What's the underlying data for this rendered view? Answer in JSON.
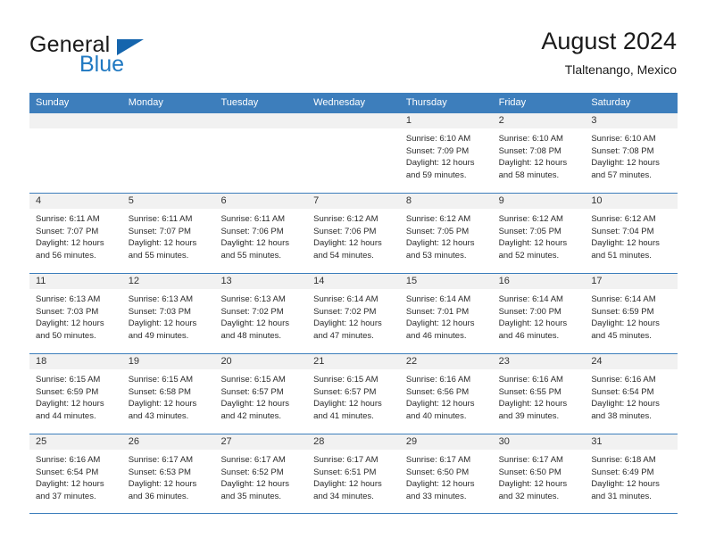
{
  "brand": {
    "name_part1": "General",
    "name_part2": "Blue",
    "flag_icon": "triangle-flag-icon"
  },
  "header": {
    "title": "August 2024",
    "subtitle": "Tlaltenango, Mexico"
  },
  "colors": {
    "header_blue": "#3d7ebc",
    "brand_blue": "#1f78c1",
    "flag_blue": "#1565ad",
    "day_band_gray": "#f1f1f1"
  },
  "weekdays": [
    "Sunday",
    "Monday",
    "Tuesday",
    "Wednesday",
    "Thursday",
    "Friday",
    "Saturday"
  ],
  "weeks": [
    [
      {
        "day": "",
        "empty": true,
        "sunrise": "",
        "sunset": "",
        "daylight_line1": "",
        "daylight_line2": ""
      },
      {
        "day": "",
        "empty": true,
        "sunrise": "",
        "sunset": "",
        "daylight_line1": "",
        "daylight_line2": ""
      },
      {
        "day": "",
        "empty": true,
        "sunrise": "",
        "sunset": "",
        "daylight_line1": "",
        "daylight_line2": ""
      },
      {
        "day": "",
        "empty": true,
        "sunrise": "",
        "sunset": "",
        "daylight_line1": "",
        "daylight_line2": ""
      },
      {
        "day": "1",
        "empty": false,
        "sunrise": "Sunrise: 6:10 AM",
        "sunset": "Sunset: 7:09 PM",
        "daylight_line1": "Daylight: 12 hours",
        "daylight_line2": "and 59 minutes."
      },
      {
        "day": "2",
        "empty": false,
        "sunrise": "Sunrise: 6:10 AM",
        "sunset": "Sunset: 7:08 PM",
        "daylight_line1": "Daylight: 12 hours",
        "daylight_line2": "and 58 minutes."
      },
      {
        "day": "3",
        "empty": false,
        "sunrise": "Sunrise: 6:10 AM",
        "sunset": "Sunset: 7:08 PM",
        "daylight_line1": "Daylight: 12 hours",
        "daylight_line2": "and 57 minutes."
      }
    ],
    [
      {
        "day": "4",
        "empty": false,
        "sunrise": "Sunrise: 6:11 AM",
        "sunset": "Sunset: 7:07 PM",
        "daylight_line1": "Daylight: 12 hours",
        "daylight_line2": "and 56 minutes."
      },
      {
        "day": "5",
        "empty": false,
        "sunrise": "Sunrise: 6:11 AM",
        "sunset": "Sunset: 7:07 PM",
        "daylight_line1": "Daylight: 12 hours",
        "daylight_line2": "and 55 minutes."
      },
      {
        "day": "6",
        "empty": false,
        "sunrise": "Sunrise: 6:11 AM",
        "sunset": "Sunset: 7:06 PM",
        "daylight_line1": "Daylight: 12 hours",
        "daylight_line2": "and 55 minutes."
      },
      {
        "day": "7",
        "empty": false,
        "sunrise": "Sunrise: 6:12 AM",
        "sunset": "Sunset: 7:06 PM",
        "daylight_line1": "Daylight: 12 hours",
        "daylight_line2": "and 54 minutes."
      },
      {
        "day": "8",
        "empty": false,
        "sunrise": "Sunrise: 6:12 AM",
        "sunset": "Sunset: 7:05 PM",
        "daylight_line1": "Daylight: 12 hours",
        "daylight_line2": "and 53 minutes."
      },
      {
        "day": "9",
        "empty": false,
        "sunrise": "Sunrise: 6:12 AM",
        "sunset": "Sunset: 7:05 PM",
        "daylight_line1": "Daylight: 12 hours",
        "daylight_line2": "and 52 minutes."
      },
      {
        "day": "10",
        "empty": false,
        "sunrise": "Sunrise: 6:12 AM",
        "sunset": "Sunset: 7:04 PM",
        "daylight_line1": "Daylight: 12 hours",
        "daylight_line2": "and 51 minutes."
      }
    ],
    [
      {
        "day": "11",
        "empty": false,
        "sunrise": "Sunrise: 6:13 AM",
        "sunset": "Sunset: 7:03 PM",
        "daylight_line1": "Daylight: 12 hours",
        "daylight_line2": "and 50 minutes."
      },
      {
        "day": "12",
        "empty": false,
        "sunrise": "Sunrise: 6:13 AM",
        "sunset": "Sunset: 7:03 PM",
        "daylight_line1": "Daylight: 12 hours",
        "daylight_line2": "and 49 minutes."
      },
      {
        "day": "13",
        "empty": false,
        "sunrise": "Sunrise: 6:13 AM",
        "sunset": "Sunset: 7:02 PM",
        "daylight_line1": "Daylight: 12 hours",
        "daylight_line2": "and 48 minutes."
      },
      {
        "day": "14",
        "empty": false,
        "sunrise": "Sunrise: 6:14 AM",
        "sunset": "Sunset: 7:02 PM",
        "daylight_line1": "Daylight: 12 hours",
        "daylight_line2": "and 47 minutes."
      },
      {
        "day": "15",
        "empty": false,
        "sunrise": "Sunrise: 6:14 AM",
        "sunset": "Sunset: 7:01 PM",
        "daylight_line1": "Daylight: 12 hours",
        "daylight_line2": "and 46 minutes."
      },
      {
        "day": "16",
        "empty": false,
        "sunrise": "Sunrise: 6:14 AM",
        "sunset": "Sunset: 7:00 PM",
        "daylight_line1": "Daylight: 12 hours",
        "daylight_line2": "and 46 minutes."
      },
      {
        "day": "17",
        "empty": false,
        "sunrise": "Sunrise: 6:14 AM",
        "sunset": "Sunset: 6:59 PM",
        "daylight_line1": "Daylight: 12 hours",
        "daylight_line2": "and 45 minutes."
      }
    ],
    [
      {
        "day": "18",
        "empty": false,
        "sunrise": "Sunrise: 6:15 AM",
        "sunset": "Sunset: 6:59 PM",
        "daylight_line1": "Daylight: 12 hours",
        "daylight_line2": "and 44 minutes."
      },
      {
        "day": "19",
        "empty": false,
        "sunrise": "Sunrise: 6:15 AM",
        "sunset": "Sunset: 6:58 PM",
        "daylight_line1": "Daylight: 12 hours",
        "daylight_line2": "and 43 minutes."
      },
      {
        "day": "20",
        "empty": false,
        "sunrise": "Sunrise: 6:15 AM",
        "sunset": "Sunset: 6:57 PM",
        "daylight_line1": "Daylight: 12 hours",
        "daylight_line2": "and 42 minutes."
      },
      {
        "day": "21",
        "empty": false,
        "sunrise": "Sunrise: 6:15 AM",
        "sunset": "Sunset: 6:57 PM",
        "daylight_line1": "Daylight: 12 hours",
        "daylight_line2": "and 41 minutes."
      },
      {
        "day": "22",
        "empty": false,
        "sunrise": "Sunrise: 6:16 AM",
        "sunset": "Sunset: 6:56 PM",
        "daylight_line1": "Daylight: 12 hours",
        "daylight_line2": "and 40 minutes."
      },
      {
        "day": "23",
        "empty": false,
        "sunrise": "Sunrise: 6:16 AM",
        "sunset": "Sunset: 6:55 PM",
        "daylight_line1": "Daylight: 12 hours",
        "daylight_line2": "and 39 minutes."
      },
      {
        "day": "24",
        "empty": false,
        "sunrise": "Sunrise: 6:16 AM",
        "sunset": "Sunset: 6:54 PM",
        "daylight_line1": "Daylight: 12 hours",
        "daylight_line2": "and 38 minutes."
      }
    ],
    [
      {
        "day": "25",
        "empty": false,
        "sunrise": "Sunrise: 6:16 AM",
        "sunset": "Sunset: 6:54 PM",
        "daylight_line1": "Daylight: 12 hours",
        "daylight_line2": "and 37 minutes."
      },
      {
        "day": "26",
        "empty": false,
        "sunrise": "Sunrise: 6:17 AM",
        "sunset": "Sunset: 6:53 PM",
        "daylight_line1": "Daylight: 12 hours",
        "daylight_line2": "and 36 minutes."
      },
      {
        "day": "27",
        "empty": false,
        "sunrise": "Sunrise: 6:17 AM",
        "sunset": "Sunset: 6:52 PM",
        "daylight_line1": "Daylight: 12 hours",
        "daylight_line2": "and 35 minutes."
      },
      {
        "day": "28",
        "empty": false,
        "sunrise": "Sunrise: 6:17 AM",
        "sunset": "Sunset: 6:51 PM",
        "daylight_line1": "Daylight: 12 hours",
        "daylight_line2": "and 34 minutes."
      },
      {
        "day": "29",
        "empty": false,
        "sunrise": "Sunrise: 6:17 AM",
        "sunset": "Sunset: 6:50 PM",
        "daylight_line1": "Daylight: 12 hours",
        "daylight_line2": "and 33 minutes."
      },
      {
        "day": "30",
        "empty": false,
        "sunrise": "Sunrise: 6:17 AM",
        "sunset": "Sunset: 6:50 PM",
        "daylight_line1": "Daylight: 12 hours",
        "daylight_line2": "and 32 minutes."
      },
      {
        "day": "31",
        "empty": false,
        "sunrise": "Sunrise: 6:18 AM",
        "sunset": "Sunset: 6:49 PM",
        "daylight_line1": "Daylight: 12 hours",
        "daylight_line2": "and 31 minutes."
      }
    ]
  ]
}
